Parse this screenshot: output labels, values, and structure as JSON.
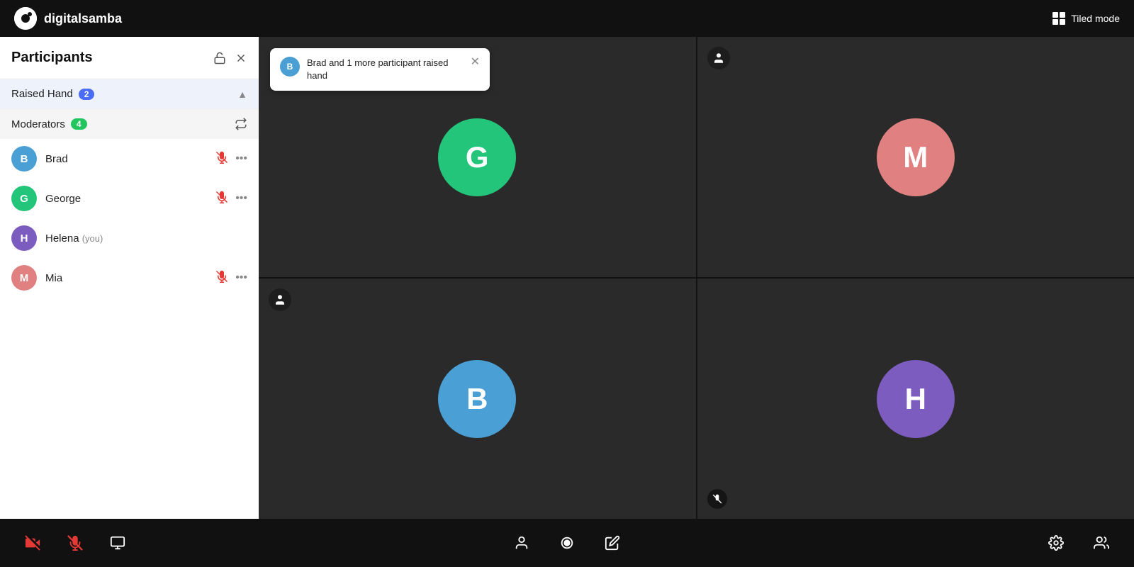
{
  "app": {
    "name": "digitalsamba",
    "tiled_mode_label": "Tiled mode"
  },
  "sidebar": {
    "title": "Participants",
    "sections": {
      "raised_hand": {
        "label": "Raised Hand",
        "count": 2
      },
      "moderators": {
        "label": "Moderators",
        "count": 4
      }
    },
    "participants": [
      {
        "id": "brad",
        "initial": "B",
        "name": "Brad",
        "you": false,
        "muted": true,
        "color": "blue"
      },
      {
        "id": "george",
        "initial": "G",
        "name": "George",
        "you": false,
        "muted": true,
        "color": "green"
      },
      {
        "id": "helena",
        "initial": "H",
        "name": "Helena",
        "you": true,
        "muted": false,
        "color": "purple"
      },
      {
        "id": "mia",
        "initial": "M",
        "name": "Mia",
        "you": false,
        "muted": true,
        "color": "pink"
      }
    ]
  },
  "notification": {
    "text": "Brad and 1 more participant raised hand",
    "avatar_initial": "B"
  },
  "video_cells": [
    {
      "id": "george-cell",
      "initial": "G",
      "color": "green",
      "has_person_icon": false,
      "has_mute": false
    },
    {
      "id": "mia-cell",
      "initial": "M",
      "color": "pink",
      "has_person_icon": true,
      "has_mute": false
    },
    {
      "id": "brad-cell",
      "initial": "B",
      "color": "blue",
      "has_person_icon": true,
      "has_mute": false
    },
    {
      "id": "helena-cell",
      "initial": "H",
      "color": "purple",
      "has_person_icon": false,
      "has_mute": true
    }
  ],
  "toolbar": {
    "left": [
      {
        "id": "camera-off",
        "label": "Camera Off"
      },
      {
        "id": "mic-off",
        "label": "Microphone Off"
      },
      {
        "id": "screen-share",
        "label": "Screen Share"
      }
    ],
    "center": [
      {
        "id": "participants-btn",
        "label": "Participants"
      },
      {
        "id": "record-btn",
        "label": "Record"
      },
      {
        "id": "annotate-btn",
        "label": "Annotate"
      }
    ],
    "right": [
      {
        "id": "settings-btn",
        "label": "Settings"
      },
      {
        "id": "more-participants-btn",
        "label": "More Participants"
      }
    ]
  }
}
